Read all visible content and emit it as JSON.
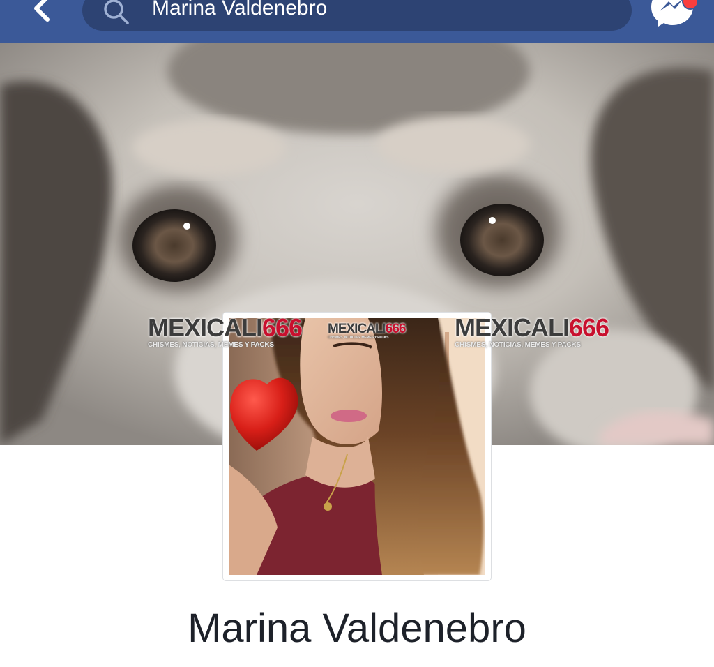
{
  "navbar": {
    "back_icon": "chevron-left-icon",
    "search_icon": "search-icon",
    "search_value": "Marina Valdenebro",
    "messenger_icon": "messenger-icon",
    "bar_color": "#3b5998"
  },
  "cover": {
    "subject": "dog close-up"
  },
  "watermarks": [
    {
      "text": "MEXICALI",
      "number": "666",
      "subtitle": "CHISMES, NOTICIAS, MEMES Y PACKS"
    },
    {
      "text": "MEXICALI",
      "number": "666",
      "subtitle": "CHISMES, NOTICIAS, MEMES Y PACKS"
    },
    {
      "text": "MEXICALI",
      "number": "666",
      "subtitle": "CHISMES, NOTICIAS, MEMES Y PACKS"
    }
  ],
  "profile": {
    "name": "Marina Valdenebro",
    "photo_sticker": "heart-icon"
  }
}
